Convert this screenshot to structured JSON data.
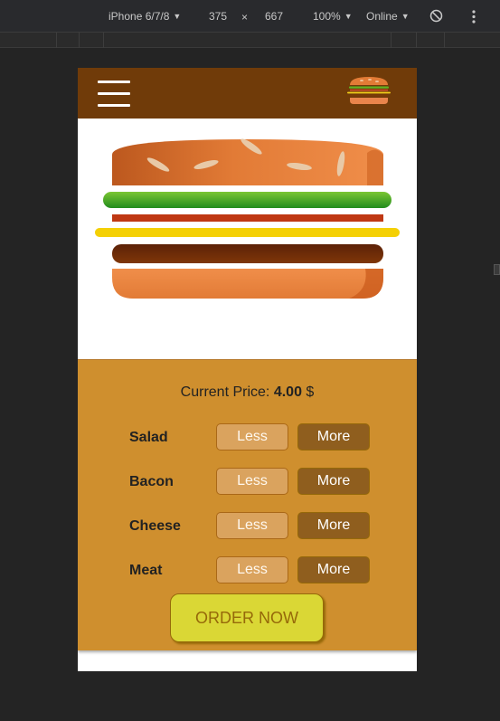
{
  "devtools": {
    "device": "iPhone 6/7/8",
    "width": "375",
    "times": "×",
    "height": "667",
    "zoom": "100%",
    "network": "Online"
  },
  "price": {
    "label": "Current Price:",
    "value": "4.00",
    "currency": "$"
  },
  "ingredients": [
    {
      "label": "Salad",
      "less": "Less",
      "more": "More"
    },
    {
      "label": "Bacon",
      "less": "Less",
      "more": "More"
    },
    {
      "label": "Cheese",
      "less": "Less",
      "more": "More"
    },
    {
      "label": "Meat",
      "less": "Less",
      "more": "More"
    }
  ],
  "order_button": "ORDER NOW",
  "colors": {
    "toolbar": "#703b09",
    "controls_bg": "#cf8f2e",
    "more_button": "#8f5e1e",
    "less_button": "#daa35e",
    "order_button": "#dad735",
    "bread": "#e27b36",
    "salad": "#228c1d",
    "bacon": "#bf3813",
    "cheese": "#f4d004",
    "meat": "#7f3608"
  },
  "icons": [
    "menu-icon",
    "burger-logo-icon",
    "rotate-icon",
    "more-options-icon"
  ]
}
